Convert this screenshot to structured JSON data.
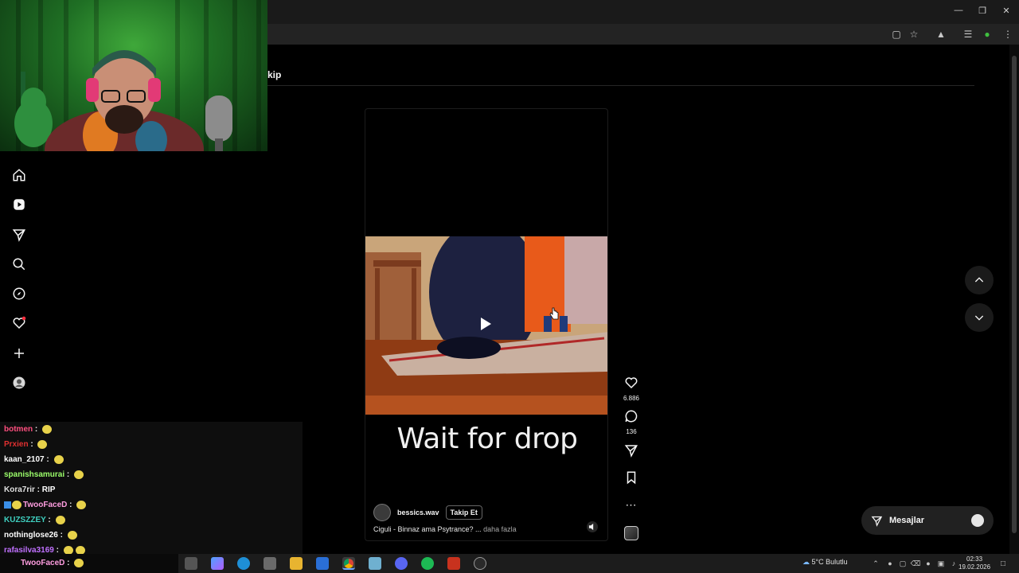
{
  "header": {
    "title": "kip"
  },
  "sidebar": {
    "items": [
      {
        "icon": "home-icon"
      },
      {
        "icon": "reels-icon"
      },
      {
        "icon": "send-icon"
      },
      {
        "icon": "search-icon"
      },
      {
        "icon": "explore-icon"
      },
      {
        "icon": "heart-icon"
      },
      {
        "icon": "plus-icon"
      },
      {
        "icon": "profile-icon"
      }
    ]
  },
  "chat": {
    "messages": [
      {
        "user": "botmen",
        "text": "",
        "color": "#ff4f7f"
      },
      {
        "user": "Prxien",
        "text": "",
        "color": "#e03030"
      },
      {
        "user": "kaan_2107",
        "text": "",
        "color": "#ffffff"
      },
      {
        "user": "spanishsamurai",
        "text": "",
        "color": "#9cff6b"
      },
      {
        "user": "Kora7rir",
        "text": "RIP",
        "color": "#e0e0e0"
      },
      {
        "user": "TwooFaceD",
        "text": "",
        "color": "#ff9de0"
      },
      {
        "user": "KUZSZZEY",
        "text": "",
        "color": "#3fd0c0"
      },
      {
        "user": "nothinglose26",
        "text": "",
        "color": "#ffffff"
      },
      {
        "user": "rafasilva3169",
        "text": "",
        "color": "#c070ff"
      },
      {
        "user": "TwooFaceD",
        "text": "",
        "color": "#ff9de0"
      }
    ]
  },
  "reel": {
    "overlay_text": "Wait for drop",
    "author": "bessics.wav",
    "follow_label": "Takip Et",
    "caption": "Ciguli - Binnaz ama Psytrance? ...",
    "caption_more": "daha fazla"
  },
  "actions": {
    "likes": "6.886",
    "comments": "136"
  },
  "messages": {
    "label": "Mesajlar"
  },
  "taskbar": {
    "weather": "5°C  Bulutlu",
    "time": "02:33",
    "date": "19.02.2026"
  },
  "colors": {
    "accent": "#ff3040",
    "background": "#000000"
  }
}
